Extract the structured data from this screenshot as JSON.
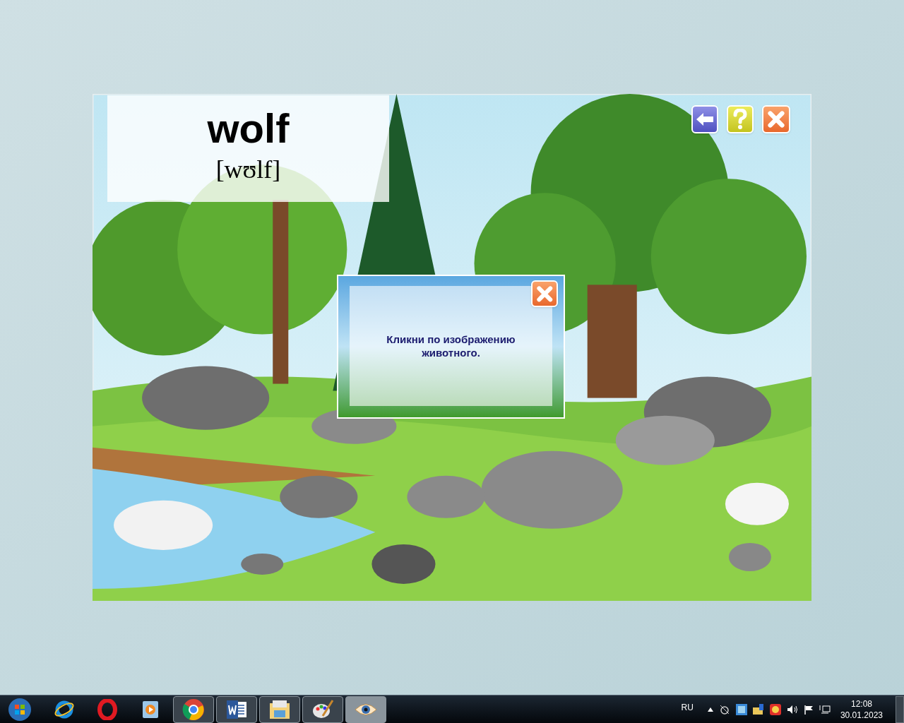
{
  "word_card": {
    "word": "wolf",
    "transcription": "[wʊlf]"
  },
  "dialog": {
    "message": "Кликни по изображению животного."
  },
  "taskbar": {
    "apps": [
      {
        "running": false,
        "selected": false
      },
      {
        "running": false,
        "selected": false
      },
      {
        "running": false,
        "selected": false
      },
      {
        "running": true,
        "selected": false
      },
      {
        "running": true,
        "selected": false
      },
      {
        "running": true,
        "selected": false
      },
      {
        "running": true,
        "selected": false
      },
      {
        "running": true,
        "selected": true
      }
    ],
    "language": "RU",
    "time": "12:08",
    "date": "30.01.2023"
  }
}
